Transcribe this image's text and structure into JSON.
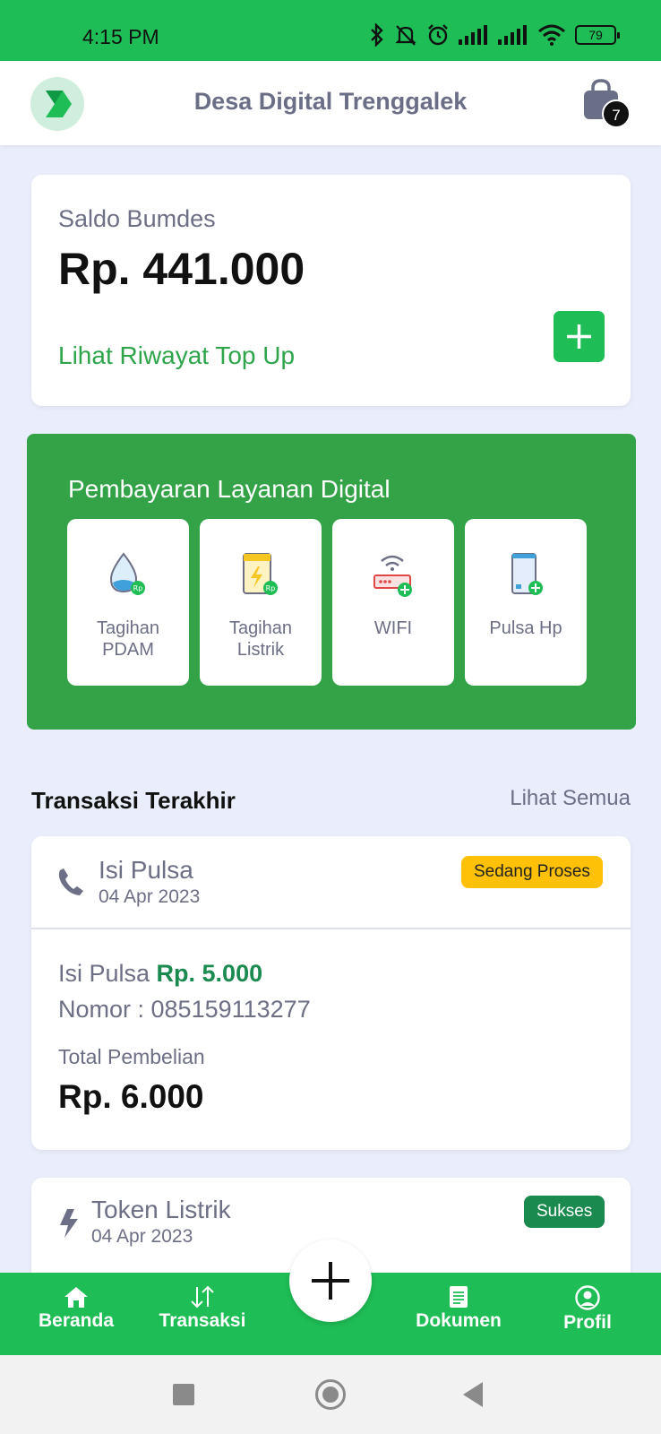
{
  "status_bar": {
    "time": "4:15 PM",
    "battery": "79"
  },
  "header": {
    "title": "Desa Digital Trenggalek",
    "cart_count": "7"
  },
  "balance": {
    "label": "Saldo Bumdes",
    "value": "Rp. 441.000",
    "history_link": "Lihat Riwayat Top Up"
  },
  "services": {
    "title": "Pembayaran Layanan Digital",
    "items": [
      {
        "label_line1": "Tagihan",
        "label_line2": "PDAM",
        "icon": "water-drop-icon"
      },
      {
        "label_line1": "Tagihan",
        "label_line2": "Listrik",
        "icon": "electricity-bill-icon"
      },
      {
        "label_line1": "WIFI",
        "label_line2": "",
        "icon": "wifi-router-icon"
      },
      {
        "label_line1": "Pulsa Hp",
        "label_line2": "",
        "icon": "phone-credit-icon"
      }
    ]
  },
  "transactions": {
    "title": "Transaksi Terakhir",
    "see_all": "Lihat Semua",
    "items": [
      {
        "title": "Isi Pulsa",
        "date": "04 Apr 2023",
        "status": "Sedang Proses",
        "detail_prefix": "Isi Pulsa ",
        "detail_amount": "Rp. 5.000",
        "number": "Nomor : 085159113277",
        "total_label": "Total Pembelian",
        "total": "Rp. 6.000",
        "icon": "phone-icon"
      },
      {
        "title": "Token Listrik",
        "date": "04 Apr 2023",
        "status": "Sukses",
        "icon": "lightning-icon"
      }
    ]
  },
  "bottom_nav": {
    "items": [
      {
        "label": "Beranda",
        "icon": "home-icon"
      },
      {
        "label": "Transaksi",
        "icon": "transfer-arrows-icon"
      },
      {
        "label": "Dokumen",
        "icon": "document-icon"
      },
      {
        "label": "Profil",
        "icon": "profile-icon"
      }
    ]
  },
  "colors": {
    "primary_green": "#1fbd55",
    "panel_green": "#34a348",
    "accent_dark_green": "#1a8a4f",
    "warning_yellow": "#ffc107",
    "background": "#eaedfb"
  }
}
